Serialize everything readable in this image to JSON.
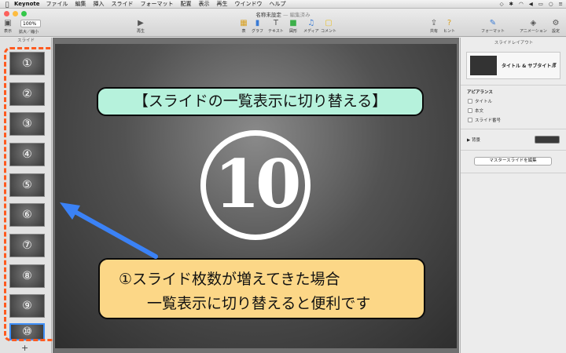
{
  "menubar": {
    "app": "Keynote",
    "items": [
      "ファイル",
      "編集",
      "挿入",
      "スライド",
      "フォーマット",
      "配置",
      "表示",
      "再生",
      "ウインドウ",
      "ヘルプ"
    ]
  },
  "window": {
    "title": "名称未設定",
    "subtitle": "— 編集済み"
  },
  "toolbar": {
    "view_label": "表示",
    "zoom_value": "100%",
    "zoom_label": "拡大／縮小",
    "play_label": "再生",
    "table_label": "表",
    "chart_label": "グラフ",
    "text_label": "テキスト",
    "shape_label": "図形",
    "media_label": "メディア",
    "comment_label": "コメント",
    "share_label": "共有",
    "tips_label": "ヒント",
    "format_label": "フォーマット",
    "animate_label": "アニメーション",
    "setup_label": "設定"
  },
  "navigator": {
    "title": "スライド",
    "slides": [
      "①",
      "②",
      "③",
      "④",
      "⑤",
      "⑥",
      "⑦",
      "⑧",
      "⑨",
      "⑩"
    ],
    "numbers": [
      "1",
      "2",
      "3",
      "4",
      "5",
      "6",
      "7",
      "8",
      "9",
      "10"
    ],
    "add": "+"
  },
  "slide": {
    "big_number": "10"
  },
  "callouts": {
    "top": "【スライドの一覧表示に切り替える】",
    "bottom_line1": "①スライド枚数が増えてきた場合",
    "bottom_line2": "一覧表示に切り替えると便利です"
  },
  "inspector": {
    "title": "スライドレイアウト",
    "layout_name": "タイトル & サブタイトル",
    "appearance_heading": "アピアランス",
    "checkbox_title": "タイトル",
    "checkbox_body": "本文",
    "checkbox_slide_number": "スライド番号",
    "background_label": "背景",
    "master_button": "マスタースライドを編集"
  },
  "colors": {
    "accent_dashed": "#ff5a1f",
    "arrow": "#3b82f6",
    "callout_top": "#b6f2dc",
    "callout_bottom": "#fcd787"
  }
}
